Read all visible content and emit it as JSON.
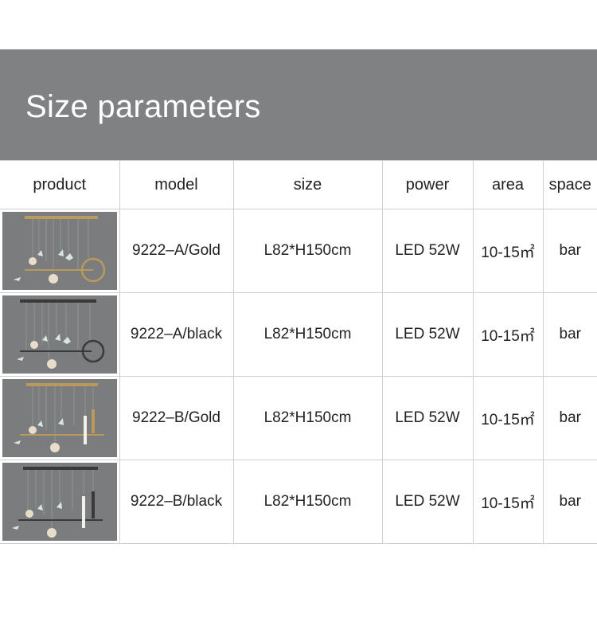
{
  "banner": {
    "title": "Size parameters"
  },
  "table": {
    "headers": {
      "product": "product",
      "model": "model",
      "size": "size",
      "power": "power",
      "area": "area",
      "space": "space"
    },
    "rows": [
      {
        "image_icon": "chandelier-gold-ring-photo",
        "model": "9222–A/Gold",
        "size": "L82*H150cm",
        "power": "LED 52W",
        "area": "10-15㎡",
        "space": "bar"
      },
      {
        "image_icon": "chandelier-black-ring-photo",
        "model": "9222–A/black",
        "size": "L82*H150cm",
        "power": "LED 52W",
        "area": "10-15㎡",
        "space": "bar"
      },
      {
        "image_icon": "chandelier-gold-bar-photo",
        "model": "9222–B/Gold",
        "size": "L82*H150cm",
        "power": "LED 52W",
        "area": "10-15㎡",
        "space": "bar"
      },
      {
        "image_icon": "chandelier-black-bar-photo",
        "model": "9222–B/black",
        "size": "L82*H150cm",
        "power": "LED 52W",
        "area": "10-15㎡",
        "space": "bar"
      }
    ]
  },
  "colors": {
    "banner_bg": "#808182",
    "gold": "#b99a5c",
    "black": "#3a3a3a",
    "photo_bg": "#7c7d7e"
  }
}
